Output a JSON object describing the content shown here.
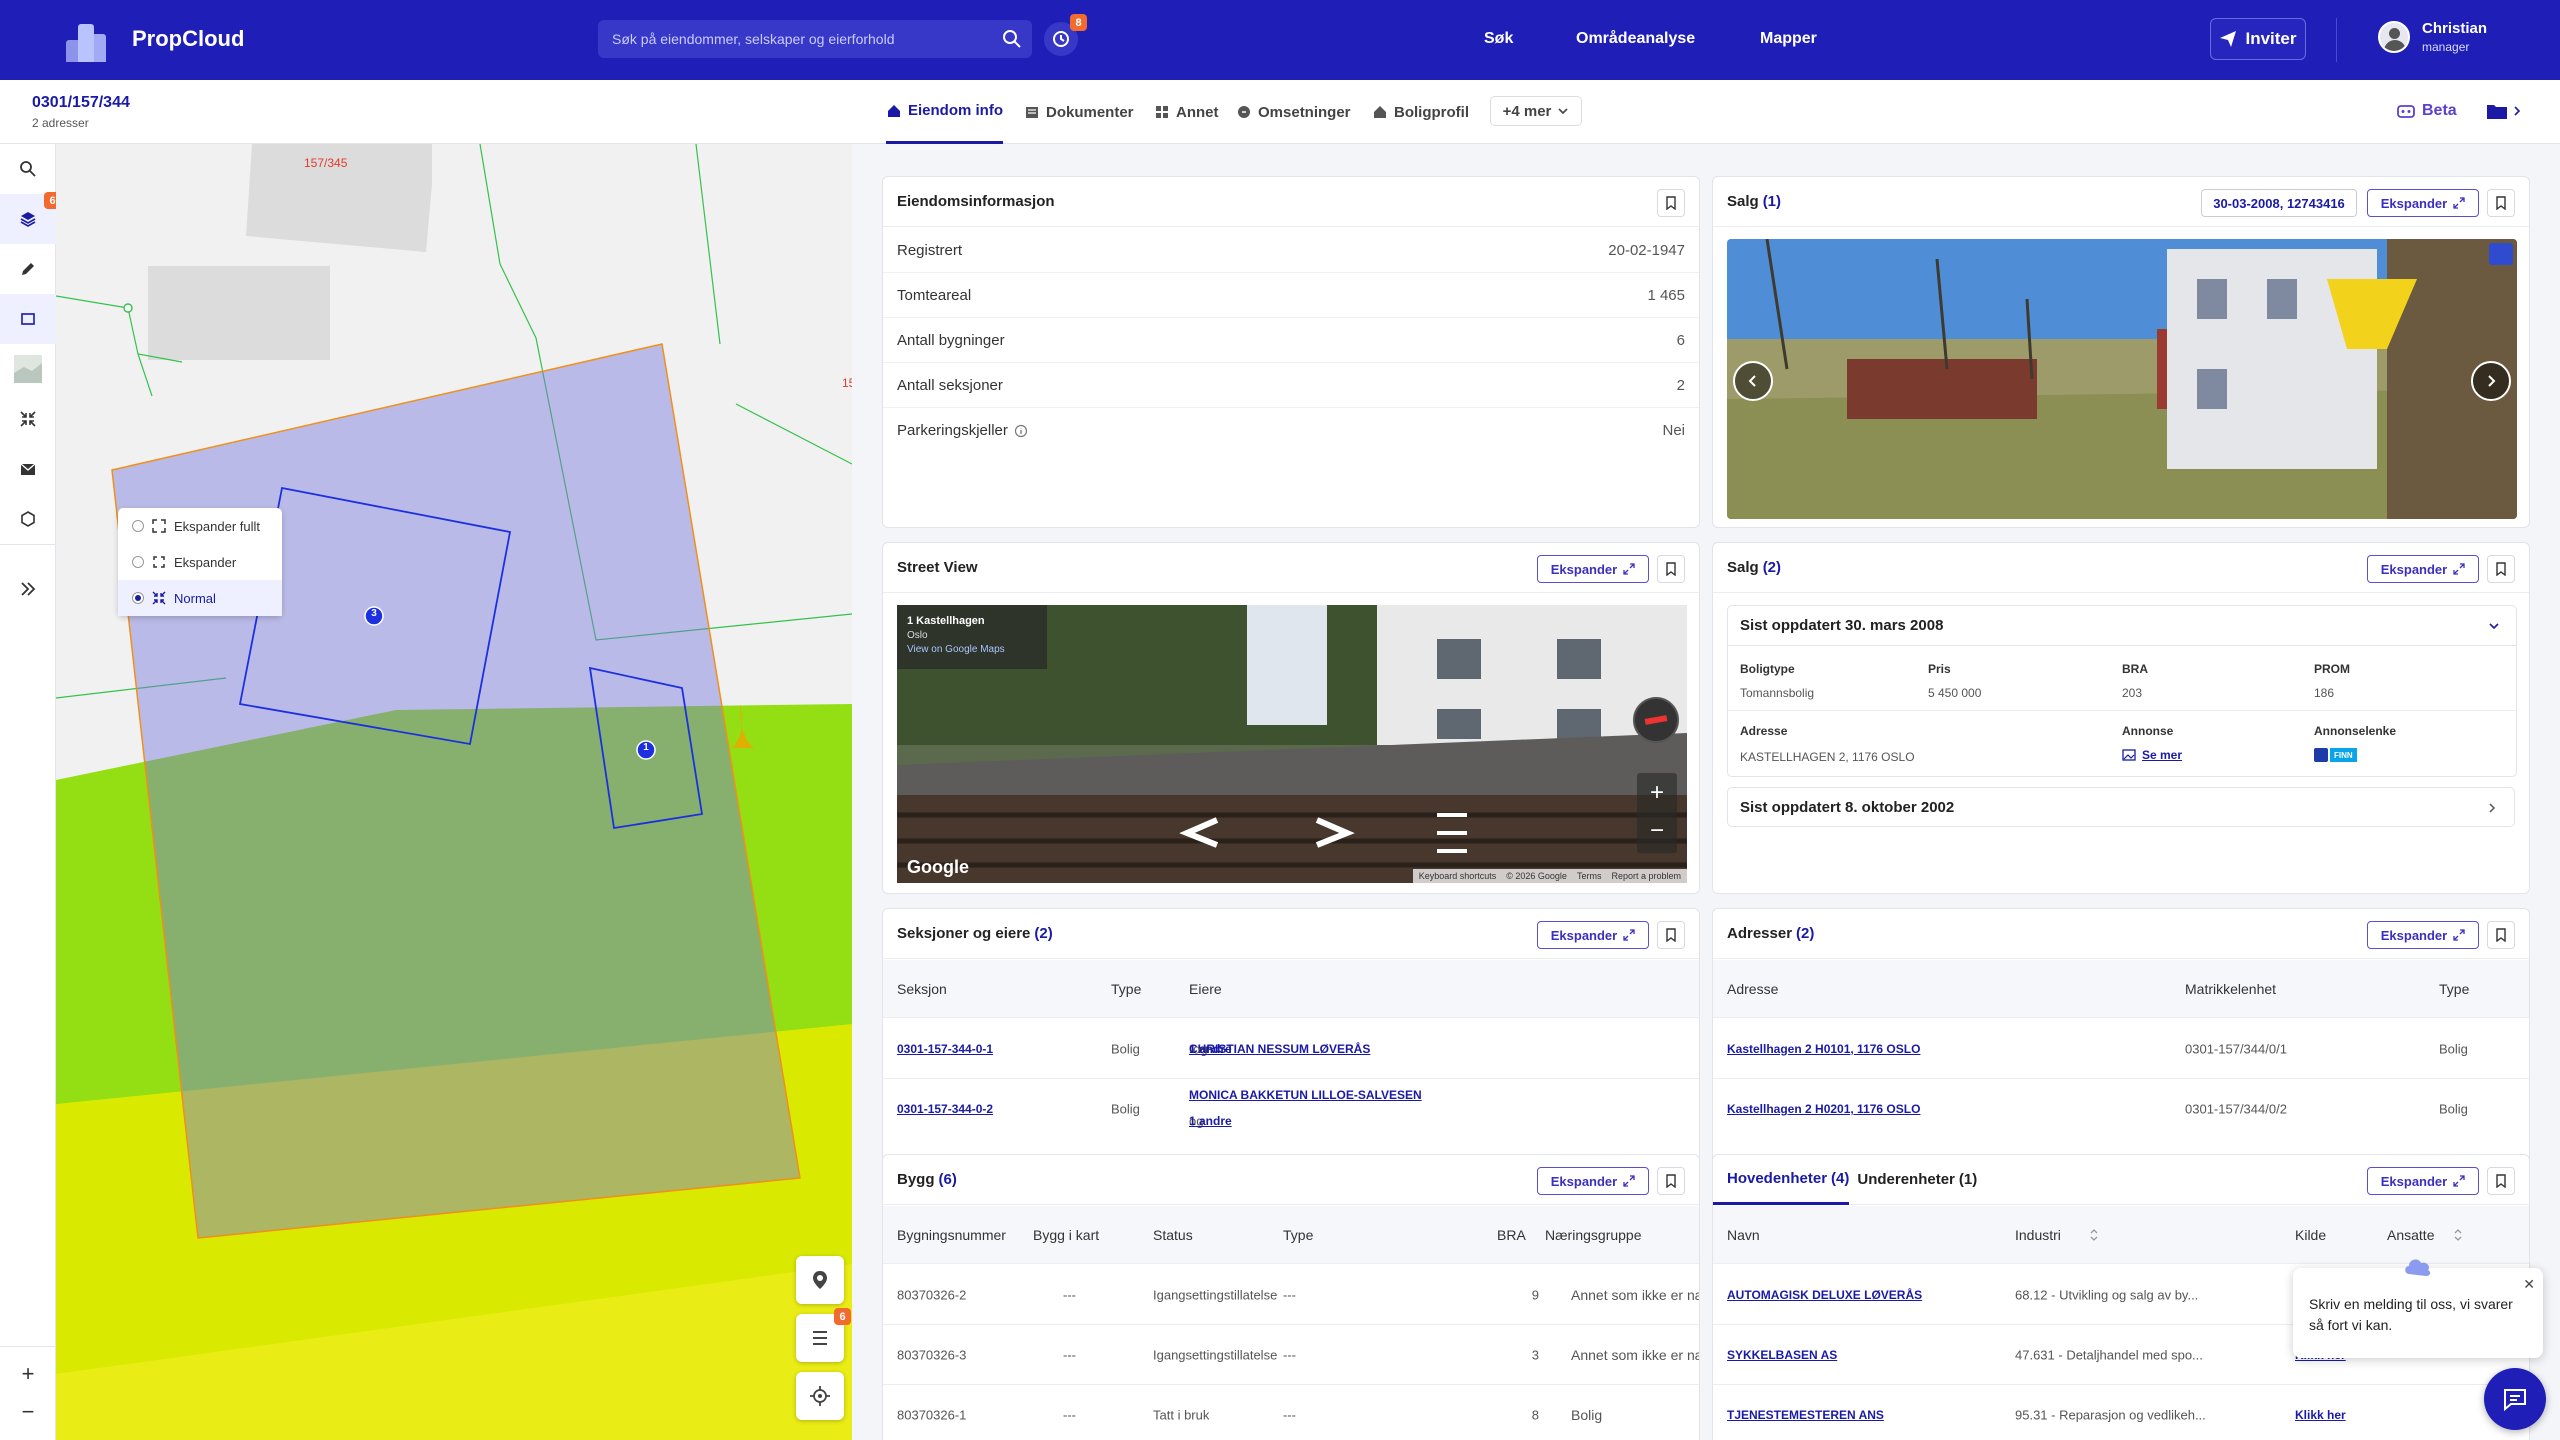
{
  "app": {
    "name": "PropCloud",
    "search_placeholder": "Søk på eiendommer, selskaper og eierforhold",
    "history_badge": "8"
  },
  "nav": {
    "links": [
      "Søk",
      "Områdeanalyse",
      "Mapper"
    ],
    "invite": "Inviter",
    "user_name": "Christian",
    "user_role": "manager"
  },
  "property": {
    "id": "0301/157/344",
    "addresses_count": "2 adresser"
  },
  "map": {
    "layers_badge": "6",
    "list_badge": "6",
    "parcel_label_top": "157/345",
    "parcel_label_right": "15",
    "building_markers": [
      "3",
      "1"
    ],
    "expand_menu": {
      "options": [
        "Ekspander fullt",
        "Ekspander",
        "Normal"
      ],
      "selected": "Normal"
    },
    "zoom_in": "+",
    "zoom_out": "−"
  },
  "tabs": [
    {
      "label": "Eiendom info",
      "active": true
    },
    {
      "label": "Dokumenter"
    },
    {
      "label": "Annet"
    },
    {
      "label": "Omsetninger"
    },
    {
      "label": "Boligprofil"
    }
  ],
  "more_tabs": "+4 mer",
  "beta_label": "Beta",
  "expand_label": "Ekspander",
  "eiendomsinfo": {
    "title": "Eiendomsinformasjon",
    "rows": [
      {
        "label": "Registrert",
        "value": "20-02-1947"
      },
      {
        "label": "Tomteareal",
        "value": "1 465"
      },
      {
        "label": "Antall bygninger",
        "value": "6"
      },
      {
        "label": "Antall seksjoner",
        "value": "2"
      },
      {
        "label": "Parkeringskjeller",
        "value": "Nei"
      }
    ]
  },
  "salg1": {
    "title": "Salg",
    "count": "(1)",
    "date_ref": "30-03-2008, 12743416"
  },
  "streetview": {
    "title": "Street View",
    "place_name": "1 Kastellhagen",
    "place_city": "Oslo",
    "maps_link": "View on Google Maps",
    "google": "Google",
    "footer": [
      "Keyboard shortcuts",
      "© 2026 Google",
      "Terms",
      "Report a problem"
    ]
  },
  "salg2": {
    "title": "Salg",
    "count": "(2)",
    "updated1": "Sist oppdatert 30. mars 2008",
    "updated2": "Sist oppdatert 8. oktober 2002",
    "fields": [
      {
        "label": "Boligtype",
        "value": "Tomannsbolig"
      },
      {
        "label": "Pris",
        "value": "5 450 000"
      },
      {
        "label": "BRA",
        "value": "203"
      },
      {
        "label": "PROM",
        "value": "186"
      }
    ],
    "adresse_label": "Adresse",
    "adresse_value": "KASTELLHAGEN 2, 1176 OSLO",
    "annonse_label": "Annonse",
    "annonse_link": "Se mer",
    "annonselenke_label": "Annonselenke",
    "finn": "FINN"
  },
  "seksjoner": {
    "title": "Seksjoner og eiere",
    "count": "(2)",
    "headers": [
      "Seksjon",
      "Type",
      "Eiere"
    ],
    "rows": [
      {
        "seksjon": "0301-157-344-0-1",
        "type": "Bolig",
        "eier": "CHRISTIAN NESSUM LØVERÅS",
        "og": "og",
        "andre": "1 andre"
      },
      {
        "seksjon": "0301-157-344-0-2",
        "type": "Bolig",
        "eier": "MONICA BAKKETUN LILLOE-SALVESEN",
        "og": "og",
        "andre": "1 andre"
      }
    ]
  },
  "adresser": {
    "title": "Adresser",
    "count": "(2)",
    "headers": [
      "Adresse",
      "Matrikkelenhet",
      "Type"
    ],
    "rows": [
      {
        "adresse": "Kastellhagen 2 H0101, 1176 OSLO",
        "matrikkel": "0301-157/344/0/1",
        "type": "Bolig"
      },
      {
        "adresse": "Kastellhagen 2 H0201, 1176 OSLO",
        "matrikkel": "0301-157/344/0/2",
        "type": "Bolig"
      }
    ]
  },
  "bygg": {
    "title": "Bygg",
    "count": "(6)",
    "headers": [
      "Bygningsnummer",
      "Bygg i kart",
      "Status",
      "Type",
      "BRA",
      "Næringsgruppe"
    ],
    "rows": [
      {
        "nr": "80370326-2",
        "kart": "---",
        "status": "Igangsettingstillatelse",
        "type": "---",
        "bra": "9",
        "gruppe": "Annet som ikke er næri"
      },
      {
        "nr": "80370326-3",
        "kart": "---",
        "status": "Igangsettingstillatelse",
        "type": "---",
        "bra": "3",
        "gruppe": "Annet som ikke er næri"
      },
      {
        "nr": "80370326-1",
        "kart": "---",
        "status": "Tatt i bruk",
        "type": "---",
        "bra": "8",
        "gruppe": "Bolig"
      }
    ]
  },
  "enheter": {
    "tab1": "Hovedenheter",
    "tab1_count": "(4)",
    "tab2": "Underenheter",
    "tab2_count": "(1)",
    "headers": [
      "Navn",
      "Industri",
      "Kilde",
      "Ansatte"
    ],
    "rows": [
      {
        "navn": "AUTOMAGISK DELUXE LØVERÅS",
        "industri": "68.12 - Utvikling og salg av by...",
        "kilde": ""
      },
      {
        "navn": "SYKKELBASEN AS",
        "industri": "47.631 - Detaljhandel med spo...",
        "kilde": "Klikk her"
      },
      {
        "navn": "TJENESTEMESTEREN ANS",
        "industri": "95.31 - Reparasjon og vedlikeh...",
        "kilde": "Klikk her"
      }
    ]
  },
  "chat": {
    "message": "Skriv en melding til oss, vi svarer så fort vi kan."
  },
  "colors": {
    "brand": "#1f1fb8",
    "accent": "#1a1aa6",
    "badge": "#f26a2e"
  }
}
